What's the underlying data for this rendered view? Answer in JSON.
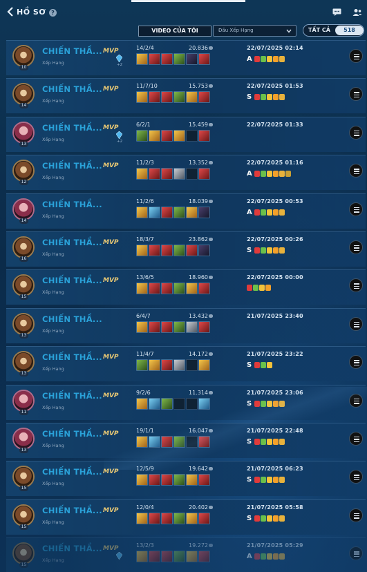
{
  "header": {
    "back_label": "HỒ SƠ",
    "video_button": "VIDEO CỦA TÔI",
    "filter_select": "Đấu Xếp Hạng",
    "toggle_label": "TẤT CẢ",
    "toggle_count": "518"
  },
  "colors": {
    "accent": "#2aa1d8",
    "mvp": "#e8c874",
    "background": "#0b2b4a"
  },
  "matches": [
    {
      "champion": "CHIẾN THẦ...",
      "mode": "Xếp Hạng",
      "mvp": "MVP",
      "level": "10",
      "kda": "14/2/4",
      "gold": "20.836",
      "datetime": "22/07/2025 02:14",
      "rank": "A",
      "gem": true,
      "gem_count": "+2",
      "avatar": "brown",
      "items": [
        "gold",
        "red",
        "red",
        "green",
        "dark",
        "red"
      ],
      "medals": 5
    },
    {
      "champion": "CHIẾN THẦ...",
      "mode": "Xếp Hạng",
      "mvp": "MVP",
      "level": "14",
      "kda": "11/7/10",
      "gold": "15.753",
      "datetime": "22/07/2025 01:53",
      "rank": "S",
      "gem": false,
      "gem_count": "",
      "avatar": "brown",
      "items": [
        "gold",
        "red",
        "red",
        "green",
        "gold",
        "red"
      ],
      "medals": 5
    },
    {
      "champion": "CHIẾN THẦ...",
      "mode": "Xếp Hạng",
      "mvp": "MVP",
      "level": "13",
      "kda": "6/2/1",
      "gold": "15.459",
      "datetime": "22/07/2025 01:33",
      "rank": "",
      "gem": true,
      "gem_count": "+2",
      "avatar": "pink",
      "items": [
        "green",
        "gold",
        "red",
        "gold",
        "empty",
        "red"
      ],
      "medals": 0
    },
    {
      "champion": "CHIẾN THẦ...",
      "mode": "Xếp Hạng",
      "mvp": "MVP",
      "level": "12",
      "kda": "11/2/3",
      "gold": "13.352",
      "datetime": "22/07/2025 01:16",
      "rank": "A",
      "gem": false,
      "gem_count": "",
      "avatar": "brown",
      "items": [
        "gold",
        "red",
        "red",
        "grey",
        "empty",
        "red"
      ],
      "medals": 6
    },
    {
      "champion": "CHIẾN THẦ...",
      "mode": "Xếp Hạng",
      "mvp": "",
      "level": "14",
      "kda": "11/2/6",
      "gold": "18.039",
      "datetime": "22/07/2025 00:53",
      "rank": "A",
      "gem": false,
      "gem_count": "",
      "avatar": "pink",
      "items": [
        "gold",
        "blue",
        "red",
        "green",
        "gold",
        "dark"
      ],
      "medals": 5
    },
    {
      "champion": "CHIẾN THẦ...",
      "mode": "Xếp Hạng",
      "mvp": "MVP",
      "level": "16",
      "kda": "18/3/7",
      "gold": "23.862",
      "datetime": "22/07/2025 00:26",
      "rank": "S",
      "gem": false,
      "gem_count": "",
      "avatar": "brown",
      "items": [
        "gold",
        "red",
        "red",
        "green",
        "red",
        "dark"
      ],
      "medals": 5
    },
    {
      "champion": "CHIẾN THẦ...",
      "mode": "Xếp Hạng",
      "mvp": "MVP",
      "level": "15",
      "kda": "13/6/5",
      "gold": "18.960",
      "datetime": "22/07/2025 00:00",
      "rank": "",
      "gem": false,
      "gem_count": "",
      "avatar": "brown",
      "items": [
        "gold",
        "red",
        "red",
        "green",
        "gold",
        "red"
      ],
      "medals": 4
    },
    {
      "champion": "CHIẾN THẦ...",
      "mode": "Xếp Hạng",
      "mvp": "",
      "level": "13",
      "kda": "6/4/7",
      "gold": "13.432",
      "datetime": "21/07/2025 23:40",
      "rank": "",
      "gem": false,
      "gem_count": "",
      "avatar": "brown",
      "items": [
        "gold",
        "red",
        "red",
        "green",
        "grey",
        "red"
      ],
      "medals": 0
    },
    {
      "champion": "CHIẾN THẦ...",
      "mode": "Xếp Hạng",
      "mvp": "MVP",
      "level": "13",
      "kda": "11/4/7",
      "gold": "14.172",
      "datetime": "21/07/2025 23:22",
      "rank": "S",
      "gem": false,
      "gem_count": "",
      "avatar": "brown",
      "items": [
        "green",
        "gold",
        "red",
        "grey",
        "empty",
        "gold"
      ],
      "medals": 3
    },
    {
      "champion": "CHIẾN THẦ...",
      "mode": "Xếp Hạng",
      "mvp": "MVP",
      "level": "11",
      "kda": "9/2/6",
      "gold": "11.314",
      "datetime": "21/07/2025 23:06",
      "rank": "S",
      "gem": false,
      "gem_count": "",
      "avatar": "pink",
      "items": [
        "gold",
        "blue",
        "green",
        "empty",
        "empty",
        "blue"
      ],
      "medals": 5
    },
    {
      "champion": "CHIẾN THẦ...",
      "mode": "Xếp Hạng",
      "mvp": "MVP",
      "level": "13",
      "kda": "19/1/1",
      "gold": "16.047",
      "datetime": "21/07/2025 22:48",
      "rank": "S",
      "gem": false,
      "gem_count": "",
      "avatar": "pink",
      "items": [
        "gold",
        "blue",
        "red",
        "green",
        "empty",
        "red"
      ],
      "medals": 5
    },
    {
      "champion": "CHIẾN THẦ...",
      "mode": "Xếp Hạng",
      "mvp": "MVP",
      "level": "15",
      "kda": "12/5/9",
      "gold": "19.642",
      "datetime": "21/07/2025 06:23",
      "rank": "S",
      "gem": false,
      "gem_count": "",
      "avatar": "brown",
      "items": [
        "gold",
        "red",
        "red",
        "green",
        "gold",
        "red"
      ],
      "medals": 5
    },
    {
      "champion": "CHIẾN THẦ...",
      "mode": "Xếp Hạng",
      "mvp": "MVP",
      "level": "15",
      "kda": "12/0/4",
      "gold": "20.402",
      "datetime": "21/07/2025 05:58",
      "rank": "S",
      "gem": false,
      "gem_count": "",
      "avatar": "brown",
      "items": [
        "gold",
        "red",
        "red",
        "green",
        "gold",
        "red"
      ],
      "medals": 5
    },
    {
      "champion": "CHIẾN THẦ...",
      "mode": "Xếp Hạng",
      "mvp": "MVP",
      "level": "15",
      "kda": "13/2/3",
      "gold": "19.272",
      "datetime": "21/07/2025 05:29",
      "rank": "A",
      "gem": true,
      "gem_count": "",
      "avatar": "brown",
      "items": [
        "gold",
        "red",
        "red",
        "green",
        "gold",
        "red"
      ],
      "medals": 5
    }
  ]
}
